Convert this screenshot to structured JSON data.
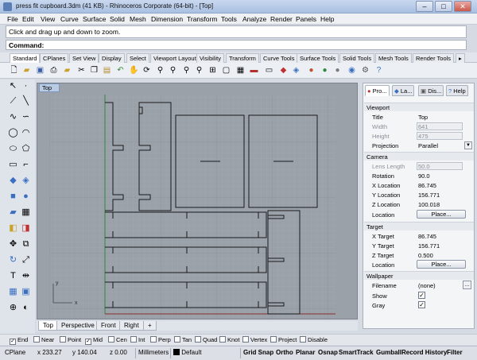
{
  "window": {
    "title": "press fit cupboard.3dm (41 KB) - Rhinoceros Corporate (64-bit) - [Top]",
    "min": "–",
    "max": "□",
    "close": "✕"
  },
  "menu": [
    "File",
    "Edit",
    "View",
    "Curve",
    "Surface",
    "Solid",
    "Mesh",
    "Dimension",
    "Transform",
    "Tools",
    "Analyze",
    "Render",
    "Panels",
    "Help"
  ],
  "command": {
    "history": "Click and drag up and down to zoom.",
    "label": "Command:",
    "value": ""
  },
  "toolbar_tabs": [
    "Standard",
    "CPlanes",
    "Set View",
    "Display",
    "Select",
    "Viewport Layout",
    "Visibility",
    "Transform",
    "Curve Tools",
    "Surface Tools",
    "Solid Tools",
    "Mesh Tools",
    "Render Tools"
  ],
  "toolbar_icons": [
    "new-icon",
    "open-icon",
    "save-icon",
    "print-icon",
    "import-icon",
    "cut-icon",
    "copy-icon",
    "paste-icon",
    "undo-icon",
    "pan-icon",
    "rotate-view-icon",
    "zoom-dynamic-icon",
    "zoom-window-icon",
    "zoom-extents-icon",
    "zoom-selected-icon",
    "four-viewports-icon",
    "maximize-viewport-icon",
    "grid-icon",
    "car-icon",
    "lock-icon",
    "color-icon",
    "layer-icon",
    "render-sphere-icon",
    "material-icon",
    "lights-icon",
    "camera-icon",
    "options-gear-icon",
    "help-icon"
  ],
  "viewport": {
    "label": "Top",
    "axis_x": "x",
    "axis_y": "y",
    "tabs": [
      "Top",
      "Perspective",
      "Front",
      "Right"
    ],
    "add_tab": "+"
  },
  "panel": {
    "tabs": [
      "Pro...",
      "La...",
      "Dis...",
      "Help"
    ],
    "sections": {
      "viewport": "Viewport",
      "camera": "Camera",
      "target": "Target",
      "wallpaper": "Wallpaper"
    },
    "viewport_rows": [
      {
        "k": "Title",
        "v": "Top"
      },
      {
        "k": "Width",
        "v": "641"
      },
      {
        "k": "Height",
        "v": "475"
      },
      {
        "k": "Projection",
        "v": "Parallel"
      }
    ],
    "camera_rows": [
      {
        "k": "Lens Length",
        "v": "50.0"
      },
      {
        "k": "Rotation",
        "v": "90.0"
      },
      {
        "k": "X Location",
        "v": "86.745"
      },
      {
        "k": "Y Location",
        "v": "156.771"
      },
      {
        "k": "Z Location",
        "v": "100.018"
      },
      {
        "k": "Location",
        "v": "Place..."
      }
    ],
    "target_rows": [
      {
        "k": "X Target",
        "v": "86.745"
      },
      {
        "k": "Y Target",
        "v": "156.771"
      },
      {
        "k": "Z Target",
        "v": "0.500"
      },
      {
        "k": "Location",
        "v": "Place..."
      }
    ],
    "wallpaper_rows": [
      {
        "k": "Filename",
        "v": "(none)",
        "btn": "..."
      },
      {
        "k": "Show",
        "checked": "✓"
      },
      {
        "k": "Gray",
        "checked": "✓"
      }
    ]
  },
  "osnap": [
    {
      "label": "End",
      "checked": "✓"
    },
    {
      "label": "Near",
      "checked": ""
    },
    {
      "label": "Point",
      "checked": ""
    },
    {
      "label": "Mid",
      "checked": "✓"
    },
    {
      "label": "Cen",
      "checked": ""
    },
    {
      "label": "Int",
      "checked": ""
    },
    {
      "label": "Perp",
      "checked": ""
    },
    {
      "label": "Tan",
      "checked": ""
    },
    {
      "label": "Quad",
      "checked": ""
    },
    {
      "label": "Knot",
      "checked": ""
    },
    {
      "label": "Vertex",
      "checked": ""
    },
    {
      "label": "Project",
      "checked": ""
    },
    {
      "label": "Disable",
      "checked": ""
    }
  ],
  "status": {
    "cplane": "CPlane",
    "x": "x 233.27",
    "y": "y 140.04",
    "z": "z 0.00",
    "units": "Millimeters",
    "layer": "Default",
    "toggles": [
      "Grid Snap",
      "Ortho",
      "Planar",
      "Osnap",
      "SmartTrack",
      "Gumball",
      "Record History",
      "Filter"
    ]
  },
  "colors": {
    "viewport_bg": "#9ba1a9",
    "grid_minor": "#a7adb4",
    "grid_major": "#8f959d",
    "y_axis": "#2e8a3a",
    "x_axis": "#8a2e2e",
    "curves": "#1a1a1a"
  }
}
